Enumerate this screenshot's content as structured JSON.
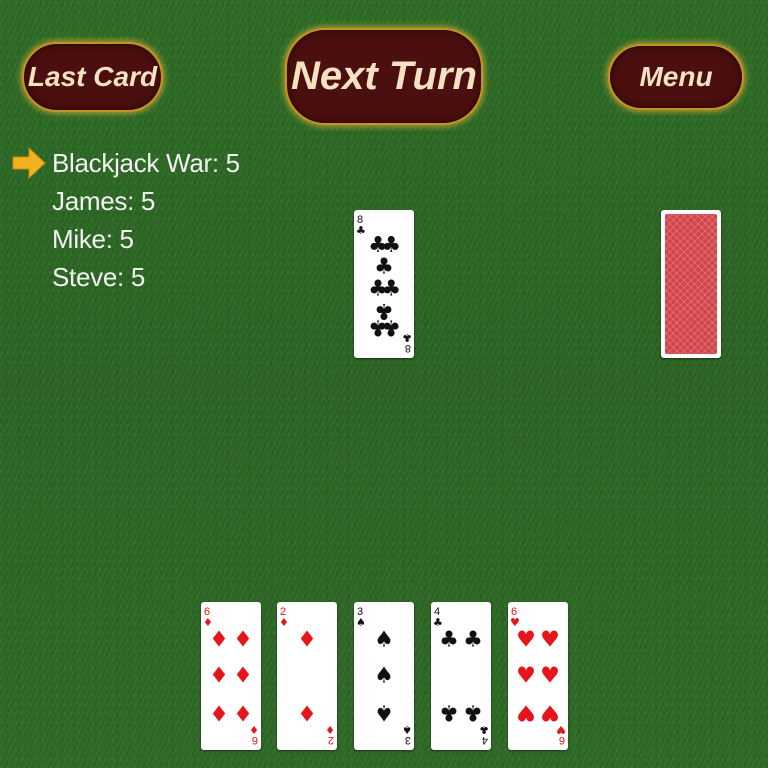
{
  "buttons": {
    "last_card": "Last Card",
    "next_turn": "Next Turn",
    "menu": "Menu"
  },
  "current_turn_player_index": 0,
  "players": [
    {
      "label": "Blackjack War: 5"
    },
    {
      "label": "James: 5"
    },
    {
      "label": "Mike: 5"
    },
    {
      "label": "Steve: 5"
    }
  ],
  "played_card": {
    "rank": "8",
    "suit": "clubs"
  },
  "deck": {
    "face": "down",
    "back_color": "#d2464a"
  },
  "hand": [
    {
      "rank": "6",
      "suit": "diamonds"
    },
    {
      "rank": "2",
      "suit": "diamonds"
    },
    {
      "rank": "3",
      "suit": "spades"
    },
    {
      "rank": "4",
      "suit": "clubs"
    },
    {
      "rank": "6",
      "suit": "hearts"
    }
  ],
  "colors": {
    "red_suit": "#e8141b",
    "black_suit": "#111111",
    "button_fill": "#4a0f0e",
    "button_border": "#c79322",
    "turn_arrow": "#f2b21f"
  }
}
